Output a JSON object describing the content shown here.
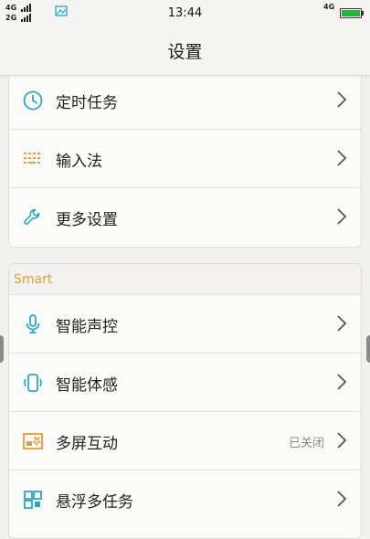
{
  "status_bar": {
    "sim1_label": "4G",
    "sim2_label": "2G",
    "time": "13:44",
    "network": "4G"
  },
  "header": {
    "title": "设置"
  },
  "group1": {
    "items": [
      {
        "label": "定时任务",
        "icon": "clock-icon"
      },
      {
        "label": "输入法",
        "icon": "keyboard-icon"
      },
      {
        "label": "更多设置",
        "icon": "wrench-icon"
      }
    ]
  },
  "smart": {
    "header": "Smart",
    "items": [
      {
        "label": "智能声控",
        "icon": "microphone-icon"
      },
      {
        "label": "智能体感",
        "icon": "phone-motion-icon"
      },
      {
        "label": "多屏互动",
        "icon": "multiscreen-icon",
        "status": "已关闭"
      },
      {
        "label": "悬浮多任务",
        "icon": "floating-window-icon"
      }
    ]
  },
  "colors": {
    "accent_teal": "#2ba9c4",
    "accent_orange": "#e89b3a",
    "battery_green": "#1fb83e"
  }
}
